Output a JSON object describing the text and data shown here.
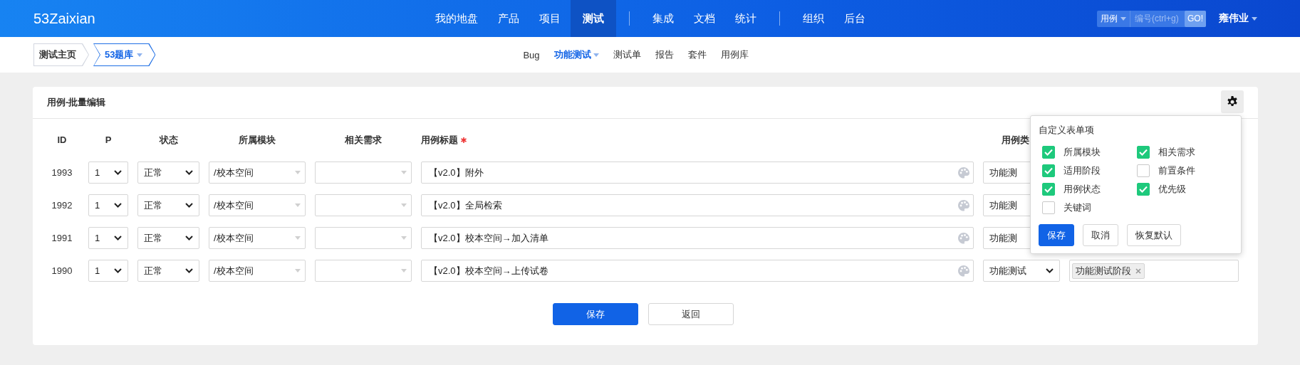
{
  "app": {
    "logo": "53Zaixian"
  },
  "nav_groups": [
    [
      {
        "label": "我的地盘",
        "selected": false
      },
      {
        "label": "产品",
        "selected": false
      },
      {
        "label": "项目",
        "selected": false
      },
      {
        "label": "测试",
        "selected": true
      }
    ],
    [
      {
        "label": "集成",
        "selected": false
      },
      {
        "label": "文档",
        "selected": false
      },
      {
        "label": "统计",
        "selected": false
      }
    ],
    [
      {
        "label": "组织",
        "selected": false
      },
      {
        "label": "后台",
        "selected": false
      }
    ]
  ],
  "search": {
    "scope": "用例",
    "placeholder": "编号(ctrl+g)",
    "button": "GO!"
  },
  "user": {
    "name": "雍伟业"
  },
  "breadcrumb": [
    {
      "label": "测试主页",
      "selected": false,
      "dropdown": false
    },
    {
      "label": "53题库",
      "selected": true,
      "dropdown": true
    }
  ],
  "subnav": [
    {
      "label": "Bug",
      "selected": false,
      "dropdown": false
    },
    {
      "label": "功能测试",
      "selected": true,
      "dropdown": true
    },
    {
      "label": "测试单",
      "selected": false,
      "dropdown": false
    },
    {
      "label": "报告",
      "selected": false,
      "dropdown": false
    },
    {
      "label": "套件",
      "selected": false,
      "dropdown": false
    },
    {
      "label": "用例库",
      "selected": false,
      "dropdown": false
    }
  ],
  "panel": {
    "title": "用例-批量编辑",
    "columns": [
      {
        "label": "ID"
      },
      {
        "label": "P"
      },
      {
        "label": "状态"
      },
      {
        "label": "所属模块"
      },
      {
        "label": "相关需求"
      },
      {
        "label": "用例标题",
        "required": true
      },
      {
        "label": "用例类"
      }
    ],
    "rows": [
      {
        "id": "1993",
        "priority": "1",
        "status": "正常",
        "module": "/校本空间",
        "title": "【v2.0】附外",
        "type": "功能测"
      },
      {
        "id": "1992",
        "priority": "1",
        "status": "正常",
        "module": "/校本空间",
        "title": "【v2.0】全局检索",
        "type": "功能测"
      },
      {
        "id": "1991",
        "priority": "1",
        "status": "正常",
        "module": "/校本空间",
        "title": "【v2.0】校本空间→加入清单",
        "type": "功能测"
      },
      {
        "id": "1990",
        "priority": "1",
        "status": "正常",
        "module": "/校本空间",
        "title": "【v2.0】校本空间→上传试卷",
        "type": "功能测试",
        "stages": [
          "功能测试阶段"
        ]
      }
    ],
    "buttons": [
      {
        "label": "保存",
        "kind": "primary"
      },
      {
        "label": "返回",
        "kind": "default"
      }
    ]
  },
  "custom_fields_popup": {
    "title": "自定义表单项",
    "options": [
      {
        "label": "所属模块",
        "checked": true
      },
      {
        "label": "相关需求",
        "checked": true
      },
      {
        "label": "适用阶段",
        "checked": true
      },
      {
        "label": "前置条件",
        "checked": false
      },
      {
        "label": "用例状态",
        "checked": true
      },
      {
        "label": "优先级",
        "checked": true
      },
      {
        "label": "关键词",
        "checked": false
      }
    ],
    "buttons": [
      {
        "label": "保存",
        "kind": "primary"
      },
      {
        "label": "取消",
        "kind": "default"
      },
      {
        "label": "恢复默认",
        "kind": "default"
      }
    ]
  }
}
